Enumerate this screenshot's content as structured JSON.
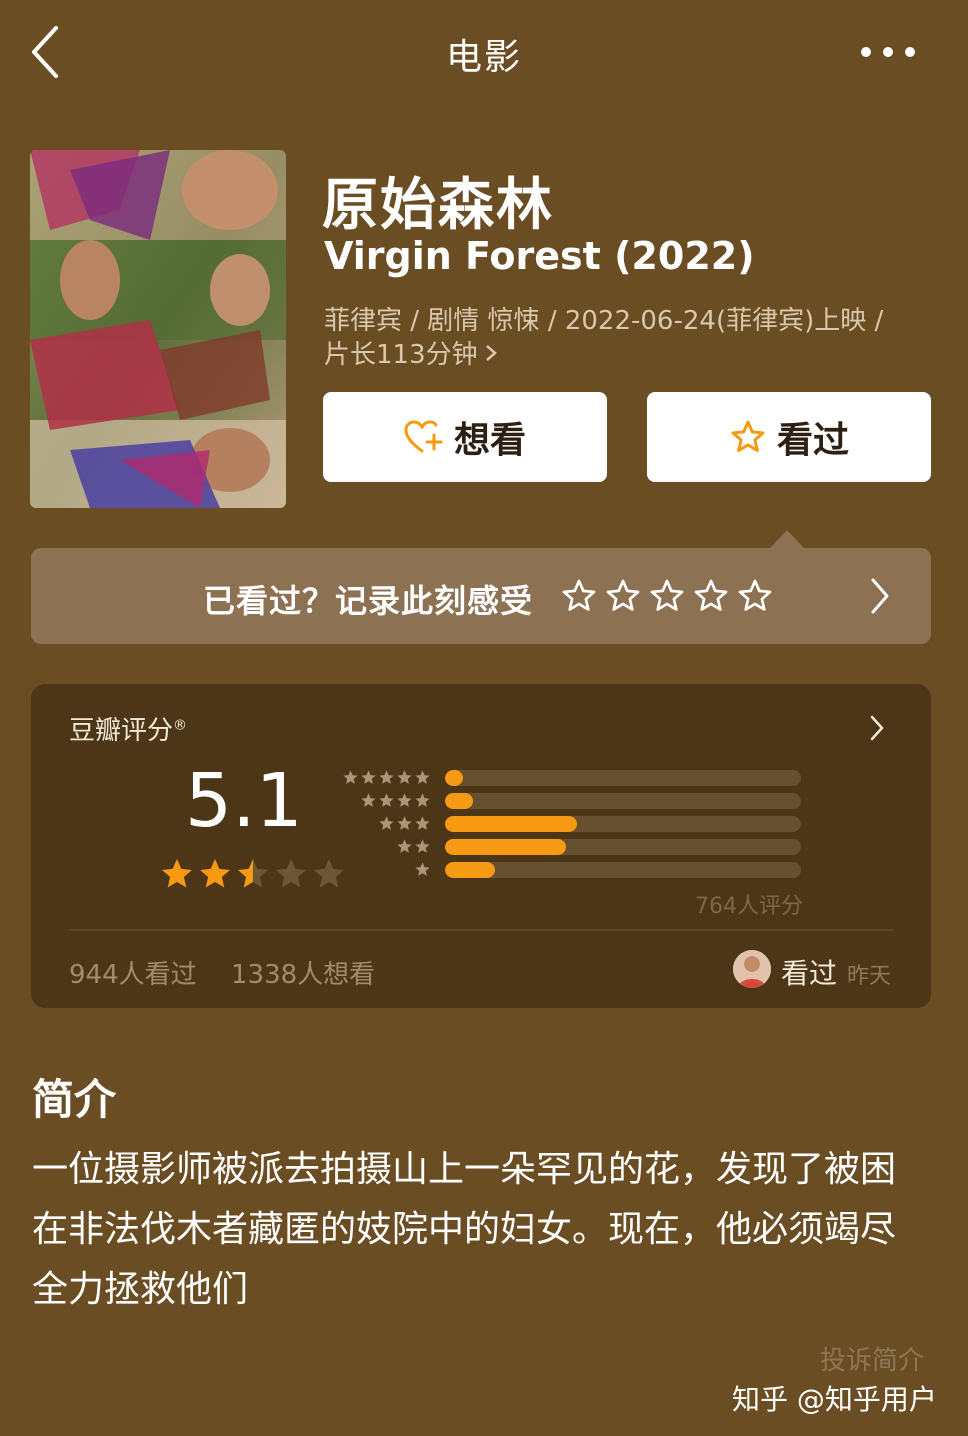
{
  "nav": {
    "title": "电影",
    "back_icon": "chevron-left-icon",
    "more_icon": "more-dots-icon"
  },
  "movie": {
    "title_cn": "原始森林",
    "title_en": "Virgin Forest (2022)",
    "meta_line1": "菲律宾 / 剧情 惊悚 / 2022-06-24(菲律宾)上映 /",
    "meta_line2": "片长113分钟",
    "meta_more_icon": "chevron-right-icon"
  },
  "actions": {
    "want_label": "想看",
    "want_icon": "heart-plus-icon",
    "seen_label": "看过",
    "seen_icon": "star-outline-icon"
  },
  "record": {
    "prompt": "已看过？记录此刻感受",
    "stars_count": 5
  },
  "rating": {
    "label": "豆瓣评分",
    "label_mark": "®",
    "score": "5.1",
    "star_value": 2.5,
    "distribution": [
      {
        "stars": 5,
        "fraction": 0.05
      },
      {
        "stars": 4,
        "fraction": 0.08
      },
      {
        "stars": 3,
        "fraction": 0.37
      },
      {
        "stars": 2,
        "fraction": 0.34
      },
      {
        "stars": 1,
        "fraction": 0.14
      }
    ],
    "count_text": "764人评分",
    "watched_text": "944人看过",
    "wish_text": "1338人想看",
    "friend_action": "看过",
    "friend_time": "昨天"
  },
  "intro": {
    "heading": "简介",
    "body": "一位摄影师被派去拍摄山上一朵罕见的花，发现了被困在非法伐木者藏匿的妓院中的妇女。现在，他必须竭尽全力拯救他们",
    "report_label": "投诉简介"
  },
  "watermark": "知乎 @知乎用户",
  "colors": {
    "background": "#6b4d23",
    "card": "#4c3617",
    "accent": "#f59a12"
  }
}
